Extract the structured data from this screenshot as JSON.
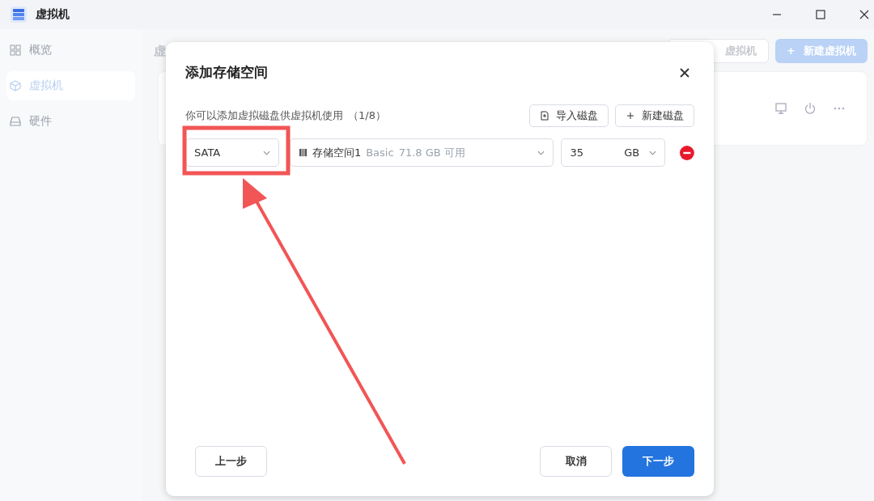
{
  "window": {
    "title": "虚拟机"
  },
  "sidebar": {
    "items": [
      {
        "label": "概览",
        "selected": false
      },
      {
        "label": "虚拟机",
        "selected": true
      },
      {
        "label": "硬件",
        "selected": false
      }
    ]
  },
  "main": {
    "heading": "虚",
    "buttons": [
      {
        "label": "虚拟机",
        "kind": "outline"
      },
      {
        "label": "新建虚拟机",
        "kind": "primary",
        "icon": "+"
      }
    ]
  },
  "dialog": {
    "title": "添加存储空间",
    "description": "你可以添加虚拟磁盘供虚拟机使用",
    "count": "（1/8）",
    "actions": [
      {
        "label": "导入磁盘"
      },
      {
        "label": "新建磁盘"
      }
    ],
    "disk": {
      "bus": "SATA",
      "pool_name": "存储空间1",
      "pool_type": "Basic",
      "pool_free": "71.8 GB 可用",
      "size": "35",
      "unit": "GB"
    },
    "footer": [
      {
        "label": "上一步",
        "kind": "secondary"
      },
      {
        "label": "取消",
        "kind": "secondary"
      },
      {
        "label": "下一步",
        "kind": "primary"
      }
    ]
  }
}
